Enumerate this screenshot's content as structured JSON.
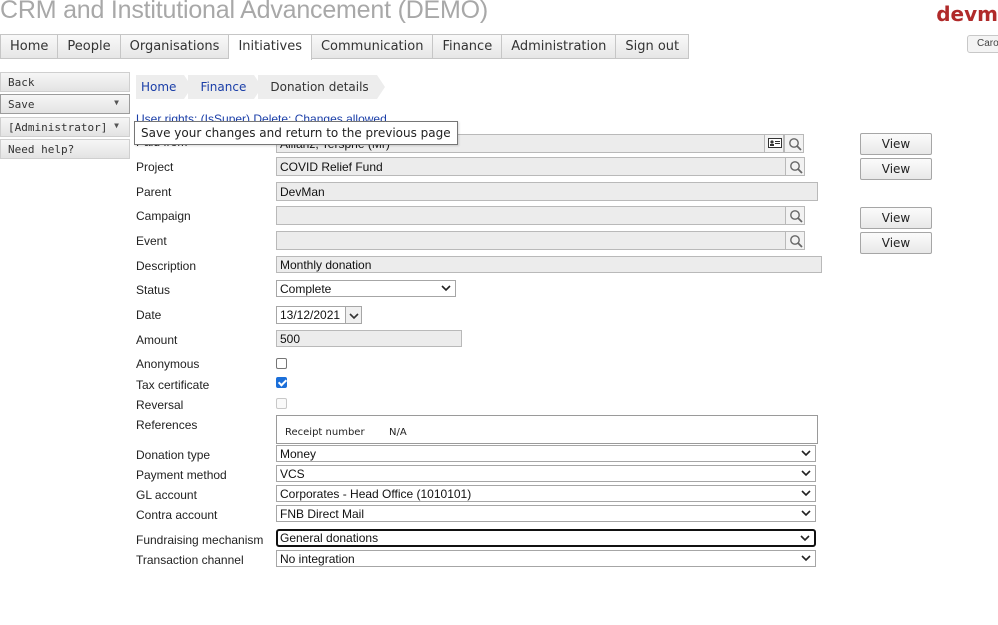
{
  "header": {
    "app_title": "CRM and Institutional Advancement (DEMO)",
    "brand_logo": "devm",
    "user_chip": "Carol"
  },
  "nav": {
    "items": [
      {
        "label": "Home"
      },
      {
        "label": "People"
      },
      {
        "label": "Organisations"
      },
      {
        "label": "Initiatives",
        "active": true
      },
      {
        "label": "Communication"
      },
      {
        "label": "Finance"
      },
      {
        "label": "Administration"
      },
      {
        "label": "Sign out"
      }
    ]
  },
  "sidebar": {
    "back": "Back",
    "save": "Save",
    "administrator": "[Administrator]",
    "help": "Need help?"
  },
  "tooltip": {
    "text": "Save your changes and return to the previous page"
  },
  "breadcrumb": {
    "items": [
      {
        "label": "Home"
      },
      {
        "label": "Finance"
      },
      {
        "label": "Donation details"
      }
    ]
  },
  "user_rights": "User rights: (IsSuper) Delete; Changes allowed",
  "form": {
    "paid_from": {
      "label": "Paid from",
      "value": "Allianz, Tersphe (Mr)"
    },
    "project": {
      "label": "Project",
      "value": "COVID Relief Fund"
    },
    "parent": {
      "label": "Parent",
      "value": "DevMan"
    },
    "campaign": {
      "label": "Campaign",
      "value": ""
    },
    "event": {
      "label": "Event",
      "value": ""
    },
    "description": {
      "label": "Description",
      "value": "Monthly donation"
    },
    "status": {
      "label": "Status",
      "value": "Complete"
    },
    "date": {
      "label": "Date",
      "value": "13/12/2021"
    },
    "amount": {
      "label": "Amount",
      "value": "500"
    },
    "anonymous": {
      "label": "Anonymous",
      "checked": false
    },
    "tax_certificate": {
      "label": "Tax certificate",
      "checked": true
    },
    "reversal": {
      "label": "Reversal",
      "checked": false
    },
    "references": {
      "label": "References",
      "receipt_label": "Receipt number",
      "receipt_value": "N/A"
    },
    "donation_type": {
      "label": "Donation type",
      "value": "Money"
    },
    "payment_method": {
      "label": "Payment method",
      "value": "VCS"
    },
    "gl_account": {
      "label": "GL account",
      "value": "Corporates - Head Office (1010101)"
    },
    "contra_account": {
      "label": "Contra account",
      "value": "FNB Direct Mail"
    },
    "fundraising_mechanism": {
      "label": "Fundraising mechanism",
      "value": "General donations"
    },
    "transaction_channel": {
      "label": "Transaction channel",
      "value": "No integration"
    }
  },
  "buttons": {
    "view": "View"
  },
  "colors": {
    "link": "#1a3ea8",
    "brand": "#b02a2a",
    "checkbox_checked": "#1b6fd9",
    "field_bg": "#ececec"
  },
  "icons": [
    "search-icon",
    "contact-card-icon",
    "chevron-down-icon",
    "calendar-dropdown-icon"
  ]
}
